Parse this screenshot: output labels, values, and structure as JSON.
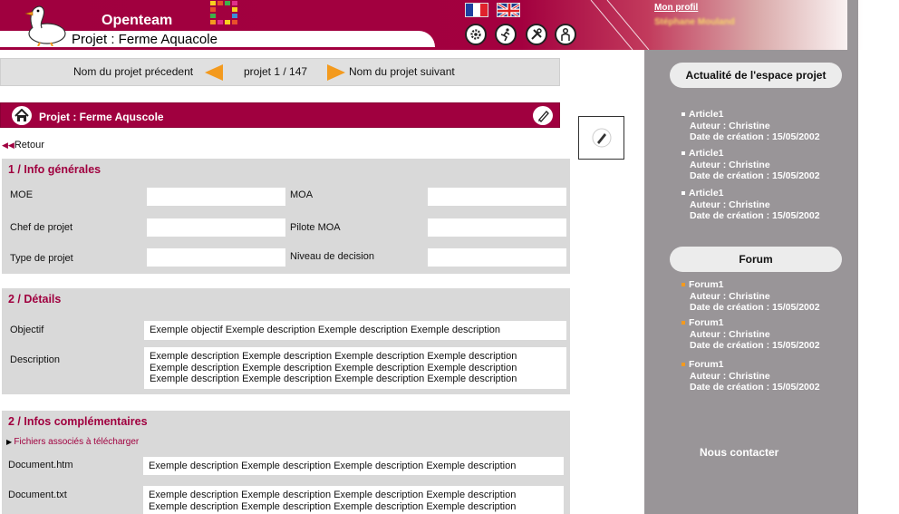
{
  "header": {
    "brand": "Openteam",
    "project_title": "Projet : Ferme Aquacole",
    "profile_link": "Mon profil",
    "profile_name": "Stéphane Mouland",
    "flags": [
      "fr-flag-icon",
      "uk-flag-icon"
    ],
    "tools": [
      "settings-gear-icon",
      "run-icon",
      "tools-icon",
      "user-icon"
    ]
  },
  "nav": {
    "prev_label": "Nom du projet précedent",
    "count": "projet 1 / 147",
    "next_label": "Nom du projet suivant"
  },
  "banner": {
    "title": "Projet : Ferme Aquscole"
  },
  "retour": "Retour",
  "section1": {
    "title": "1 / Info générales",
    "labels": [
      "MOE",
      "MOA",
      "Chef de projet",
      "Pilote MOA",
      "Type de projet",
      "Niveau de decision"
    ]
  },
  "section2": {
    "title": "2 / Détails",
    "objectif_label": "Objectif",
    "objectif_value": "Exemple objectif Exemple description Exemple description Exemple description",
    "description_label": "Description",
    "description_lines": [
      "Exemple description Exemple description Exemple description Exemple description",
      "Exemple description Exemple description Exemple description Exemple description",
      "Exemple description Exemple description Exemple description Exemple description"
    ]
  },
  "section3": {
    "title": "2 / Infos complémentaires",
    "files_link": "Fichiers associés à télécharger",
    "doc1_label": "Document.htm",
    "doc1_value": "Exemple description Exemple description Exemple description Exemple description",
    "doc2_label": "Document.txt",
    "doc2_lines": [
      "Exemple description Exemple description Exemple description Exemple description",
      "Exemple description Exemple description Exemple description Exemple description"
    ]
  },
  "sidebar": {
    "news_title": "Actualité de l'espace projet",
    "news": [
      {
        "title": "Article1",
        "author": "Auteur : Christine",
        "date": "Date de création : 15/05/2002"
      },
      {
        "title": "Article1",
        "author": "Auteur : Christine",
        "date": "Date de création : 15/05/2002"
      },
      {
        "title": "Article1",
        "author": "Auteur : Christine",
        "date": "Date de création : 15/05/2002"
      }
    ],
    "forum_title": "Forum",
    "forum": [
      {
        "title": "Forum1",
        "author": "Auteur : Christine",
        "date": "Date de création : 15/05/2002"
      },
      {
        "title": "Forum1",
        "author": "Auteur : Christine",
        "date": "Date de création : 15/05/2002"
      },
      {
        "title": "Forum1",
        "author": "Auteur : Christine",
        "date": "Date de création : 15/05/2002"
      }
    ],
    "contact": "Nous contacter"
  },
  "colors": {
    "brand": "#a0003f",
    "nav_arrow": "#f39a1e",
    "sidebar_bg": "#999598",
    "news_bullet": "#ffffff",
    "forum_bullet": "#f39a1e"
  }
}
